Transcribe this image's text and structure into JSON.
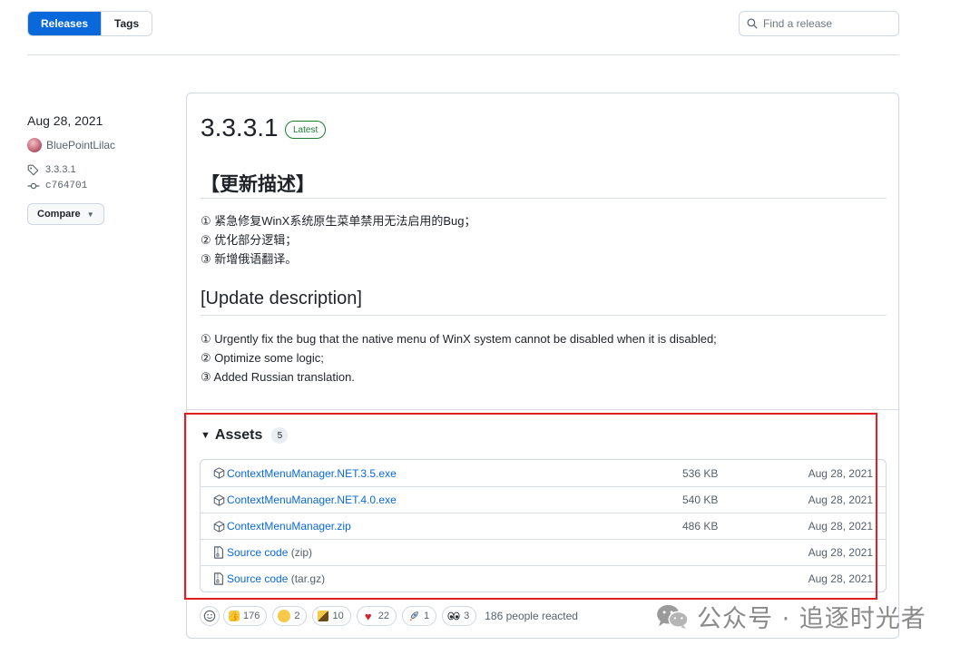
{
  "tabs": {
    "releases": "Releases",
    "tags": "Tags"
  },
  "search": {
    "placeholder": "Find a release"
  },
  "meta": {
    "date": "Aug 28, 2021",
    "author": "BluePointLilac",
    "tag": "3.3.3.1",
    "commit": "c764701",
    "compare_label": "Compare"
  },
  "release": {
    "title": "3.3.3.1",
    "badge": "Latest",
    "cn_heading": "【更新描述】",
    "cn_lines": [
      "① 紧急修复WinX系统原生菜单禁用无法启用的Bug；",
      "② 优化部分逻辑；",
      "③ 新增俄语翻译。"
    ],
    "en_heading": "[Update description]",
    "en_lines": [
      "① Urgently fix the bug that the native menu of WinX system cannot be disabled when it is disabled;",
      "② Optimize some logic;",
      "③ Added Russian translation."
    ]
  },
  "assets": {
    "label": "Assets",
    "count": "5",
    "items": [
      {
        "name": "ContextMenuManager.NET.3.5.exe",
        "suffix": "",
        "size": "536 KB",
        "date": "Aug 28, 2021",
        "icon": "package-icon"
      },
      {
        "name": "ContextMenuManager.NET.4.0.exe",
        "suffix": "",
        "size": "540 KB",
        "date": "Aug 28, 2021",
        "icon": "package-icon"
      },
      {
        "name": "ContextMenuManager.zip",
        "suffix": "",
        "size": "486 KB",
        "date": "Aug 28, 2021",
        "icon": "package-icon"
      },
      {
        "name": "Source code",
        "suffix": " (zip)",
        "size": "",
        "date": "Aug 28, 2021",
        "icon": "file-zip-icon"
      },
      {
        "name": "Source code",
        "suffix": " (tar.gz)",
        "size": "",
        "date": "Aug 28, 2021",
        "icon": "file-zip-icon"
      }
    ]
  },
  "reactions": {
    "items": [
      {
        "emoji": "thumbs-up",
        "count": "176"
      },
      {
        "emoji": "laugh",
        "count": "2"
      },
      {
        "emoji": "hooray",
        "count": "10"
      },
      {
        "emoji": "heart",
        "count": "22"
      },
      {
        "emoji": "rocket",
        "count": "1"
      },
      {
        "emoji": "eyes",
        "count": "3"
      }
    ],
    "total": "186 people reacted"
  },
  "watermark": {
    "text": "公众号 · 追逐时光者"
  },
  "colors": {
    "accent": "#0969da",
    "highlight": "#e02020",
    "latest": "#1a7f37"
  }
}
